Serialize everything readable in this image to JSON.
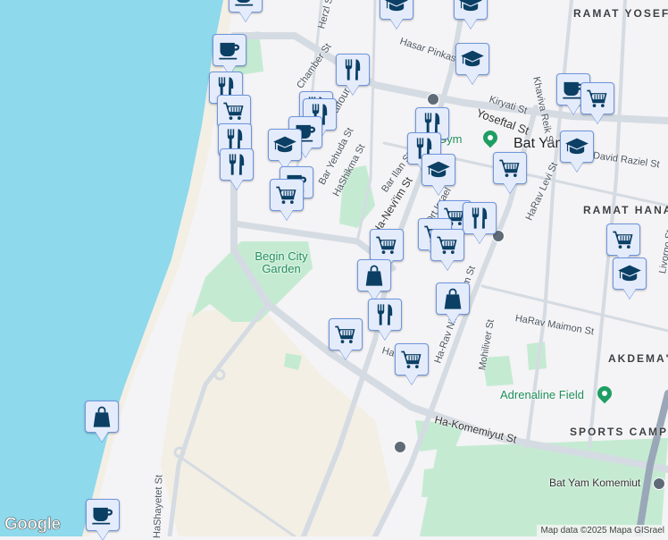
{
  "map": {
    "colors": {
      "water": "#8ed9ec",
      "sand": "#f3efe4",
      "park": "#c4ebd2",
      "road": "#d5dbe2",
      "marker_bg": "#e4ecfc",
      "marker_border": "#6e95dc",
      "icon": "#0b3f64",
      "poi": "#1e8e5a"
    },
    "areas": [
      "RAMAT YOSEF",
      "RAMAT HANA",
      "AKDEMA'I",
      "SPORTS CAMPU"
    ],
    "city": "Bat Yam",
    "pois": {
      "gym": "Gym",
      "field": "Adrenaline Field",
      "garden": "Begin City Garden",
      "station": "Bat Yam Komemiut"
    },
    "streets": {
      "hasar_pinkas": "Hasar Pinkas St",
      "kiryati": "Kiryati St",
      "yoseftal": "Yoseftal St",
      "khaviva": "Khaviva Reik St",
      "david_raziel": "David Raziel St",
      "harav_levi": "HaRav Levi St",
      "balfour": "Balfour St",
      "bar_yehuda": "Bar Yehuda St",
      "hashikma": "HaShikma St",
      "bar_ilan": "Bar Ilan St",
      "ha_neviim": "Ha-Nevi'im St",
      "ort_israel": "Ort Israel",
      "ha_rav_kook": "Ha-Rav Nissenbaum St",
      "harav_maimon": "HaRav Maimon St",
      "mohiliver": "Mohiliver St",
      "ha_komemiyut": "Ha-Komemiyut St",
      "hashayetet": "HaShayetet St",
      "herzl": "Herzl St",
      "jabotinsky": "Ha-Sh...",
      "chamber": "Chamber St",
      "livorno": "Livorno St"
    },
    "markers": [
      {
        "type": "cafe"
      },
      {
        "type": "school"
      },
      {
        "type": "school"
      },
      {
        "type": "cafe"
      },
      {
        "type": "restaurant"
      },
      {
        "type": "restaurant"
      },
      {
        "type": "school"
      },
      {
        "type": "cart"
      },
      {
        "type": "restaurant"
      },
      {
        "type": "restaurant"
      },
      {
        "type": "cafe"
      },
      {
        "type": "restaurant"
      },
      {
        "type": "school"
      },
      {
        "type": "restaurant"
      },
      {
        "type": "cafe"
      },
      {
        "type": "cart"
      },
      {
        "type": "restaurant"
      },
      {
        "type": "restaurant"
      },
      {
        "type": "school"
      },
      {
        "type": "cart"
      },
      {
        "type": "cafe"
      },
      {
        "type": "cart"
      },
      {
        "type": "school"
      },
      {
        "type": "cart"
      },
      {
        "type": "restaurant"
      },
      {
        "type": "cart"
      },
      {
        "type": "cart"
      },
      {
        "type": "cart"
      },
      {
        "type": "cart"
      },
      {
        "type": "school"
      },
      {
        "type": "shopping"
      },
      {
        "type": "shopping"
      },
      {
        "type": "restaurant"
      },
      {
        "type": "cart"
      },
      {
        "type": "cart"
      },
      {
        "type": "shopping"
      },
      {
        "type": "cafe"
      }
    ],
    "logo": "Google",
    "attribution": "Map data ©2025 Mapa GISrael"
  }
}
